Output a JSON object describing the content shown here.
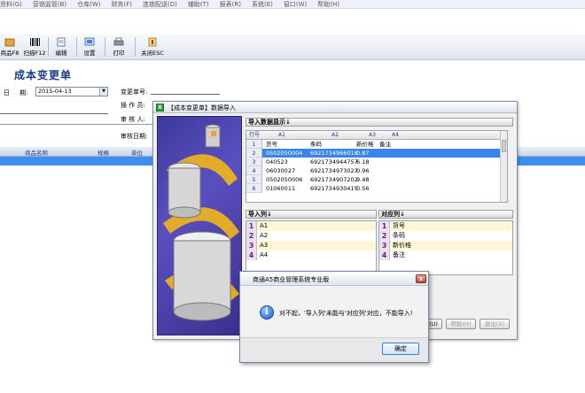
{
  "menubar": {
    "items": [
      "资料(G)",
      "营销监管(B)",
      "仓库(W)",
      "财务(F)",
      "连锁配送(D)",
      "辅助(T)",
      "报表(R)",
      "系统(E)",
      "窗口(W)",
      "帮助(H)"
    ]
  },
  "toolbar": {
    "items": [
      {
        "label": "商品F8"
      },
      {
        "label": "扫描F12"
      },
      {
        "label": "编辑"
      },
      {
        "label": "设置"
      },
      {
        "label": "打印"
      },
      {
        "label": "关闭ESC"
      }
    ]
  },
  "document": {
    "title": "成本变更单",
    "date_label_1": "日",
    "date_label_2": "期:",
    "date_value": "2015-04-13",
    "change_no_label": "变更单号:",
    "operator_label": "操 作 员:",
    "reviewer_label": "审 核 人:",
    "review_date_label": "审核日期:"
  },
  "grid": {
    "columns": [
      "商品名称",
      "规格",
      "单位"
    ]
  },
  "import_dialog": {
    "title": "【成本变更单】数据导入",
    "data_display_label": "导入数据显示↓",
    "table": {
      "column_headers": [
        "行号",
        "A1",
        "A2",
        "A3",
        "A4"
      ],
      "rows": [
        {
          "no": "1",
          "a1": "货号",
          "a2": "条码",
          "a3": "新价格",
          "a4": "备注"
        },
        {
          "no": "2",
          "a1": "0502050004",
          "a2": "6921734966018",
          "a3": "0.87",
          "a4": ""
        },
        {
          "no": "3",
          "a1": "040523",
          "a2": "6921734944757",
          "a3": "6.18",
          "a4": ""
        },
        {
          "no": "4",
          "a1": "06030027",
          "a2": "6921734973023",
          "a3": "0.96",
          "a4": ""
        },
        {
          "no": "5",
          "a1": "0502050006",
          "a2": "6921734907202",
          "a3": "9.48",
          "a4": ""
        },
        {
          "no": "6",
          "a1": "01060011",
          "a2": "6921734930415",
          "a3": "0.56",
          "a4": ""
        }
      ]
    },
    "import_columns_label": "导入列↓",
    "import_columns": [
      {
        "n": "1",
        "v": "A1"
      },
      {
        "n": "2",
        "v": "A2"
      },
      {
        "n": "3",
        "v": "A3"
      },
      {
        "n": "4",
        "v": "A4"
      }
    ],
    "target_columns_label": "对应列↓",
    "target_columns": [
      {
        "n": "1",
        "v": "货号"
      },
      {
        "n": "2",
        "v": "条码"
      },
      {
        "n": "3",
        "v": "新价格"
      },
      {
        "n": "4",
        "v": "备注"
      }
    ],
    "buttons": {
      "partial": "(U)",
      "help": "帮助(H)",
      "exit": "退出(X)"
    }
  },
  "message_box": {
    "title": "商通A5商业管理系统专业版",
    "text": "对不起，'导入列'未能与'对应列'对应，不能导入!",
    "ok_label": "确定",
    "close_glyph": "x",
    "icon_glyph": "i"
  },
  "colors": {
    "accent_blue": "#3a86e8",
    "title_blue": "#1a3a8a",
    "ok_border": "#3d7bd8"
  }
}
